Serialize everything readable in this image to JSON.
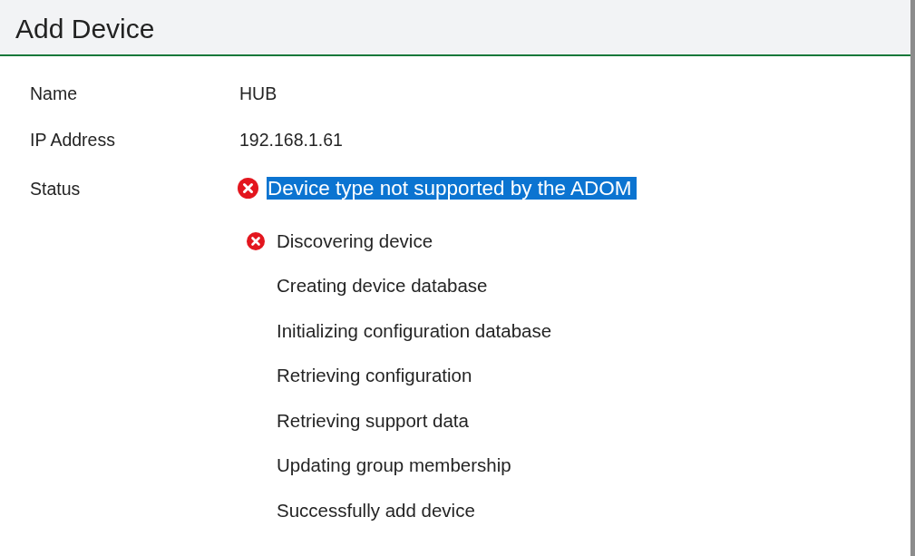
{
  "dialog": {
    "title": "Add Device"
  },
  "fields": [
    {
      "label": "Name",
      "value": "HUB"
    },
    {
      "label": "IP Address",
      "value": "192.168.1.61"
    }
  ],
  "status": {
    "label": "Status",
    "failed": true,
    "message": "Device type not supported by the ADOM",
    "highlighted": true
  },
  "steps": [
    {
      "label": "Discovering device",
      "failed": true
    },
    {
      "label": "Creating device database",
      "failed": false
    },
    {
      "label": "Initializing configuration database",
      "failed": false
    },
    {
      "label": "Retrieving configuration",
      "failed": false
    },
    {
      "label": "Retrieving support data",
      "failed": false
    },
    {
      "label": "Updating group membership",
      "failed": false
    },
    {
      "label": "Successfully add device",
      "failed": false
    }
  ]
}
